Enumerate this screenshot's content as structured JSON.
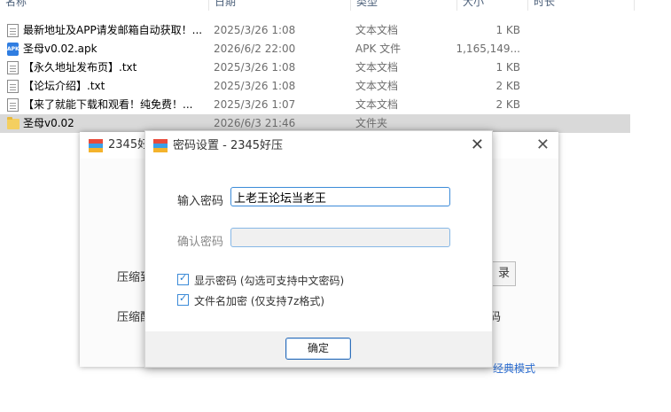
{
  "explorer": {
    "headers": [
      "名称",
      "日期",
      "类型",
      "大小",
      "时长"
    ],
    "files": [
      {
        "name": "最新地址及APP请发邮箱自动获取！...",
        "date": "2025/3/26 1:08",
        "type": "文本文档",
        "size": "1 KB",
        "icon": "text-file-icon"
      },
      {
        "name": "圣母v0.02.apk",
        "date": "2026/6/2 22:00",
        "type": "APK 文件",
        "size": "1,165,149...",
        "icon": "apk-file-icon"
      },
      {
        "name": "【永久地址发布页】.txt",
        "date": "2025/3/26 1:08",
        "type": "文本文档",
        "size": "1 KB",
        "icon": "text-file-icon"
      },
      {
        "name": "【论坛介绍】.txt",
        "date": "2025/3/26 1:08",
        "type": "文本文档",
        "size": "2 KB",
        "icon": "text-file-icon"
      },
      {
        "name": "【来了就能下载和观看！纯免费！...",
        "date": "2025/3/26 1:07",
        "type": "文本文档",
        "size": "2 KB",
        "icon": "text-file-icon"
      },
      {
        "name": "圣母v0.02",
        "date": "2026/6/3 21:46",
        "type": "文件夹",
        "size": "",
        "icon": "folder-icon"
      }
    ],
    "apk_badge": "APK"
  },
  "compress_window": {
    "title": "2345好",
    "label_1": "压缩到",
    "label_2": "压缩配",
    "browse_partial": "录",
    "password_partial": "码",
    "classic_mode": "经典模式"
  },
  "password_dialog": {
    "title": "密码设置 - 2345好压",
    "password_label": "输入密码",
    "password_value": "上老王论坛当老王",
    "confirm_label": "确认密码",
    "confirm_value": "",
    "show_password_label": "显示密码 (勾选可支持中文密码)",
    "encrypt_names_label": "文件名加密  (仅支持7z格式)",
    "ok_button": "确定"
  },
  "colors": {
    "accent": "#3c8bd8",
    "selection": "#d9d9d9",
    "link": "#2b6ccf"
  }
}
